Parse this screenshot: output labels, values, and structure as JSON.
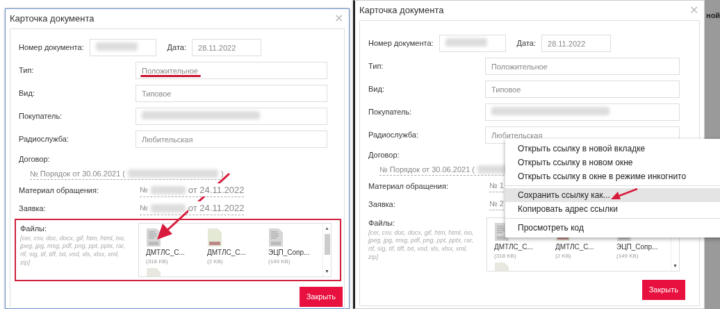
{
  "panels": [
    {
      "title": "Карточка документа",
      "doc_number_label": "Номер документа:",
      "date_label": "Дата:",
      "date": "28.11.2022",
      "fields": [
        {
          "label": "Тип:",
          "value": "Положительное",
          "underlined": true
        },
        {
          "label": "Вид:",
          "value": "Типовое",
          "underlined": false
        },
        {
          "label": "Покупатель:",
          "redacted": true
        },
        {
          "label": "Радиослужба:",
          "value": "Любительская",
          "underlined": false
        }
      ],
      "contract_label": "Договор:",
      "contract": "№ Порядок от 30.06.2021 (",
      "contract_end": ")",
      "links": [
        {
          "label": "Материал обращения:",
          "prefix": "№",
          "suffix": "от 24.11.2022"
        },
        {
          "label": "Заявка:",
          "prefix": "№",
          "suffix": "от 24.11.2022"
        }
      ],
      "files_label": "Файлы:",
      "files_hint": "[cer, csv, doc, docx, gif, htm, html, iso, jpeg, jpg, msg, pdf, png, ppt, pptx, rar, rtf, sig, tif, tiff, txt, vsd, xls, xlsx, xml, zip]",
      "files": [
        {
          "kind": "doc",
          "name": "ДМТЛС_С...",
          "size": "(318 KB)"
        },
        {
          "kind": "image",
          "name": "ДМТЛС_С...",
          "size": "(2 KB)"
        },
        {
          "kind": "doc",
          "name": "ЭЦП_Сопр...",
          "size": "(149 KB)"
        },
        {
          "kind": "blank"
        }
      ],
      "files_highlighted": true,
      "arrow_annotation": true,
      "close": "Закрыть",
      "close_icon": "✕",
      "scroll_up": "▲",
      "scroll_down": "▼"
    },
    {
      "title": "Карточка документа",
      "doc_number_label": "Номер документа:",
      "date_label": "Дата:",
      "date": "28.11.2022",
      "fields": [
        {
          "label": "Тип:",
          "value": "Положительное",
          "underlined": false
        },
        {
          "label": "Вид:",
          "value": "Типовое",
          "underlined": false
        },
        {
          "label": "Покупатель:",
          "redacted": true
        },
        {
          "label": "Радиослужба:",
          "value": "Любительская",
          "underlined": false
        }
      ],
      "contract_label": "Договор:",
      "contract": "№ Порядок от 30.06.2021 (",
      "links": [
        {
          "label": "Материал обращения:",
          "prefix": "№ 1"
        },
        {
          "label": "Заявка:",
          "prefix": "№ 2"
        }
      ],
      "files_label": "Файлы:",
      "files_hint": "[cer, csv, doc, docx, gif, htm, html, iso, jpeg, jpg, msg, pdf, png, ppt, pptx, rar, rtf, sig, tif, tiff, txt, vsd, xls, xlsx, xml, zip]",
      "files": [
        {
          "kind": "doc",
          "name": "ДМТЛС_С...",
          "size": "(318 KB)"
        },
        {
          "kind": "image",
          "name": "ДМТЛС_С...",
          "size": "(2 KB)"
        },
        {
          "kind": "doc",
          "name": "ЭЦП_Сопр...",
          "size": "(149 KB)"
        },
        {
          "kind": "blank"
        }
      ],
      "arrow_annotation": true,
      "close": "Закрыть",
      "close_icon": "✕",
      "scroll_down": "▼",
      "background_text": "ной",
      "context_menu": [
        {
          "label": "Открыть ссылку в новой вкладке",
          "selected": false
        },
        {
          "label": "Открыть ссылку в новом окне",
          "selected": false
        },
        {
          "label": "Открыть ссылку в окне в режиме инкогнито",
          "selected": false
        },
        {
          "kind": "separator"
        },
        {
          "label": "Сохранить ссылку как...",
          "selected": true
        },
        {
          "label": "Копировать адрес ссылки",
          "selected": false
        },
        {
          "kind": "separator"
        },
        {
          "label": "Просмотреть код",
          "selected": false
        }
      ]
    }
  ]
}
